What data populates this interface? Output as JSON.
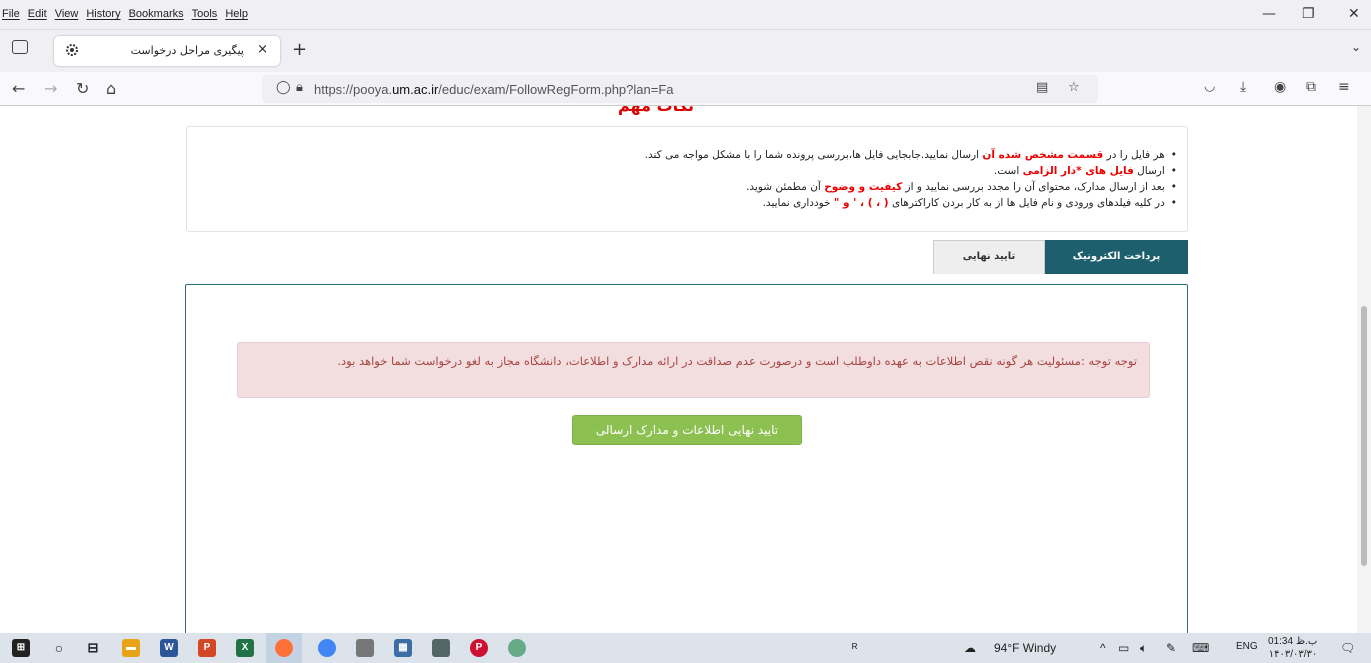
{
  "menubar": {
    "items": [
      "File",
      "Edit",
      "View",
      "History",
      "Bookmarks",
      "Tools",
      "Help"
    ]
  },
  "browser_tab": {
    "title": "پیگیری مراحل درخواست",
    "close": "×",
    "new_tab": "+"
  },
  "nav": {
    "url_prefix": "https://pooya.",
    "url_domain": "um.ac.ir",
    "url_path": "/educ/exam/FollowRegForm.php?lan=Fa"
  },
  "page": {
    "heading": "نکات مهم",
    "notices": [
      {
        "before": "هر فایل را در ",
        "highlight": "قسمت مشخص شده آن",
        "after": " ارسال نمایید.جابجایی فایل ها،بررسی پرونده شما را با مشکل مواجه می کند."
      },
      {
        "before": "ارسال ",
        "highlight": "فایل های *دار الزامی",
        "after": " است."
      },
      {
        "before": "بعد از ارسال مدارک، محتوای آن را مجدد بررسی نمایید و از ",
        "highlight": "کیفیت و وضوح",
        "after": " آن مطمئن شوید."
      },
      {
        "before": "در کلیه فیلدهای ورودی و نام فایل ها از به کار بردن کاراکترهای ",
        "highlight": "( ، ) ، ' و \"",
        "after": " خودداری نمایید."
      }
    ],
    "tabs": {
      "final_confirm": "تایید نهایی",
      "electronic_payment": "پرداخت الکترونیک"
    },
    "alert": "توجه توجه :مسئولیت هر گونه نقص اطلاعات به عهده داوطلب است و درصورت عدم صداقت در ارائه مدارک و اطلاعات، دانشگاه مجاز به لغو درخواست شما خواهد بود.",
    "confirm_button": "تایید نهایی اطلاعات و مدارک ارسالی"
  },
  "taskbar": {
    "weather": "94°F  Windy",
    "lang": "ENG",
    "time": "01:34 ب.ظ",
    "date": "۱۴۰۳/۰۳/۳۰"
  },
  "colors": {
    "accent_teal": "#1e5f6e",
    "success_green": "#8cc152",
    "alert_bg": "#f2dede",
    "alert_text": "#a94442",
    "highlight_red": "#e00000"
  }
}
